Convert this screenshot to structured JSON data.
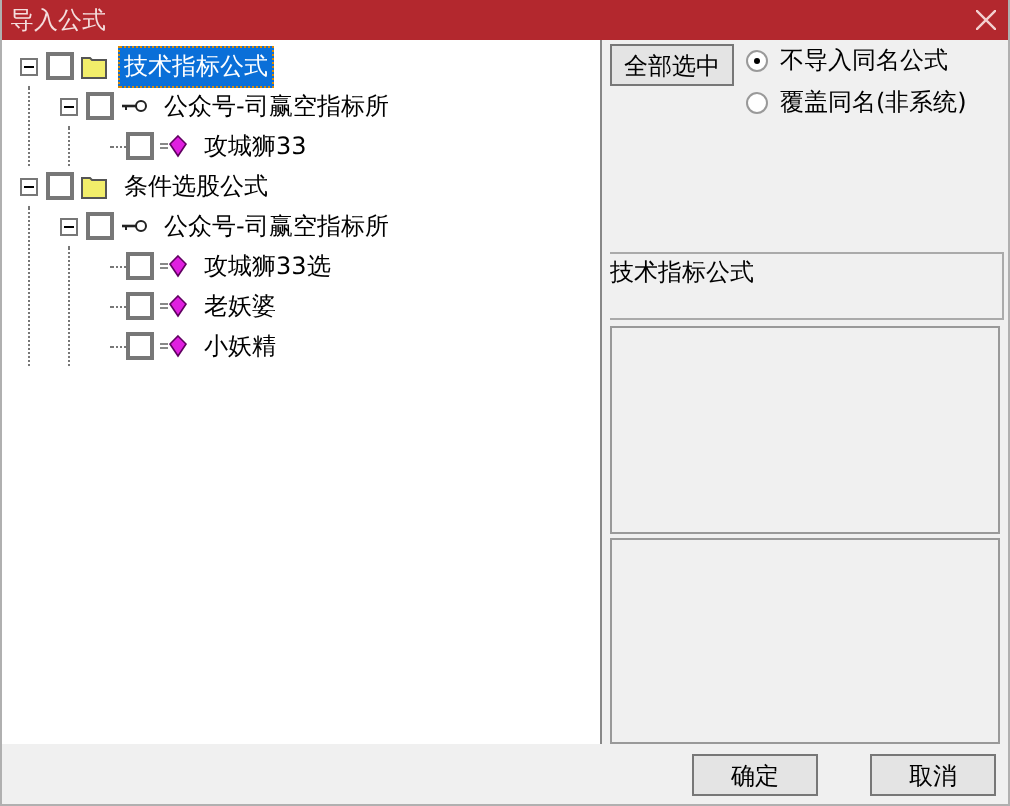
{
  "window": {
    "title": "导入公式"
  },
  "tree": [
    {
      "label": "技术指标公式",
      "kind": "folder",
      "expanded": true,
      "checked": false,
      "selected": true,
      "children": [
        {
          "label": "公众号-司赢空指标所",
          "kind": "key",
          "expanded": true,
          "checked": false,
          "selected": false,
          "children": [
            {
              "label": "攻城狮33",
              "kind": "formula",
              "checked": false,
              "selected": false
            }
          ]
        }
      ]
    },
    {
      "label": "条件选股公式",
      "kind": "folder",
      "expanded": true,
      "checked": false,
      "selected": false,
      "children": [
        {
          "label": "公众号-司赢空指标所",
          "kind": "key",
          "expanded": true,
          "checked": false,
          "selected": false,
          "children": [
            {
              "label": "攻城狮33选",
              "kind": "formula",
              "checked": false,
              "selected": false
            },
            {
              "label": "老妖婆",
              "kind": "formula",
              "checked": false,
              "selected": false
            },
            {
              "label": "小妖精",
              "kind": "formula",
              "checked": false,
              "selected": false
            }
          ]
        }
      ]
    }
  ],
  "select_all_button": "全部选中",
  "options": [
    {
      "label": "不导入同名公式",
      "selected": true
    },
    {
      "label": "覆盖同名(非系统)",
      "selected": false
    }
  ],
  "info_label": "技术指标公式",
  "buttons": [
    "确定",
    "取消"
  ]
}
